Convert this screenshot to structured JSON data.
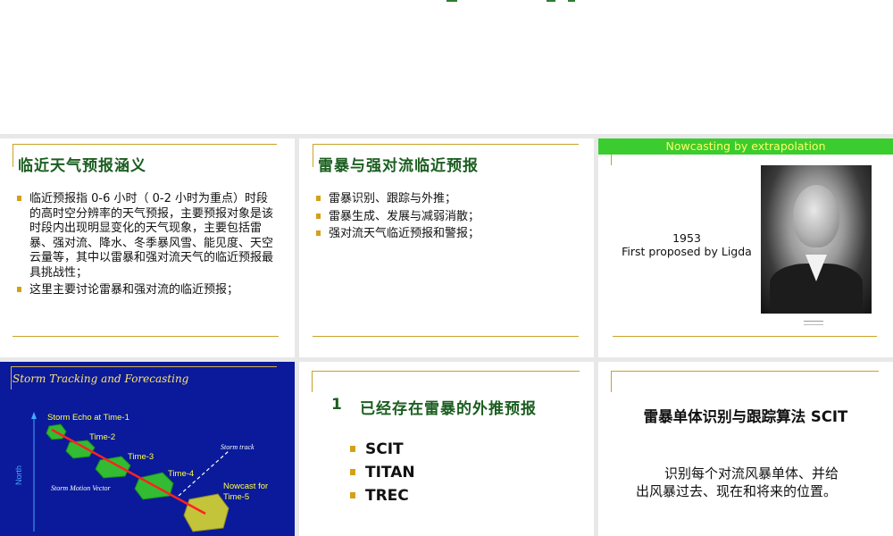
{
  "slide1": {
    "title": "临近天气预报涵义",
    "bullet1": "临近预报指 0-6 小时（ 0-2 小时为重点）时段的高时空分辨率的天气预报，主要预报对象是该时段内出现明显变化的天气现象，主要包括雷暴、强对流、降水、冬季暴风雪、能见度、天空云量等，其中以雷暴和强对流天气的临近预报最具挑战性；",
    "bullet2": "这里主要讨论雷暴和强对流的临近预报；"
  },
  "slide2": {
    "title": "雷暴与强对流临近预报",
    "bullets": [
      "雷暴识别、跟踪与外推；",
      "雷暴生成、发展与减弱消散；",
      "强对流天气临近预报和警报；"
    ]
  },
  "slide3": {
    "header": "Nowcasting by extrapolation",
    "year": "1953",
    "caption": "First proposed by Ligda"
  },
  "slide4": {
    "title": "Storm Tracking and Forecasting",
    "labels": {
      "time1": "Storm Echo at Time-1",
      "time2": "Time-2",
      "time3": "Time-3",
      "time4": "Time-4",
      "nowcast": "Nowcast for",
      "time5": "Time-5",
      "track": "Storm track",
      "vector": "Storm Motion Vector",
      "north": "North"
    },
    "colors": {
      "background": "#0a1a9a",
      "echo": "#33bb33",
      "nowcast_echo": "#c4c43a",
      "track": "#ff2222"
    }
  },
  "slide5": {
    "number": "1",
    "title": "已经存在雷暴的外推预报",
    "bullets": [
      "SCIT",
      "TITAN",
      "TREC"
    ]
  },
  "slide6": {
    "title": "雷暴单体识别与跟踪算法 SCIT",
    "desc_line1": "识别每个对流风暴单体、并给",
    "desc_line2": "出风暴过去、现在和将来的位置。"
  }
}
